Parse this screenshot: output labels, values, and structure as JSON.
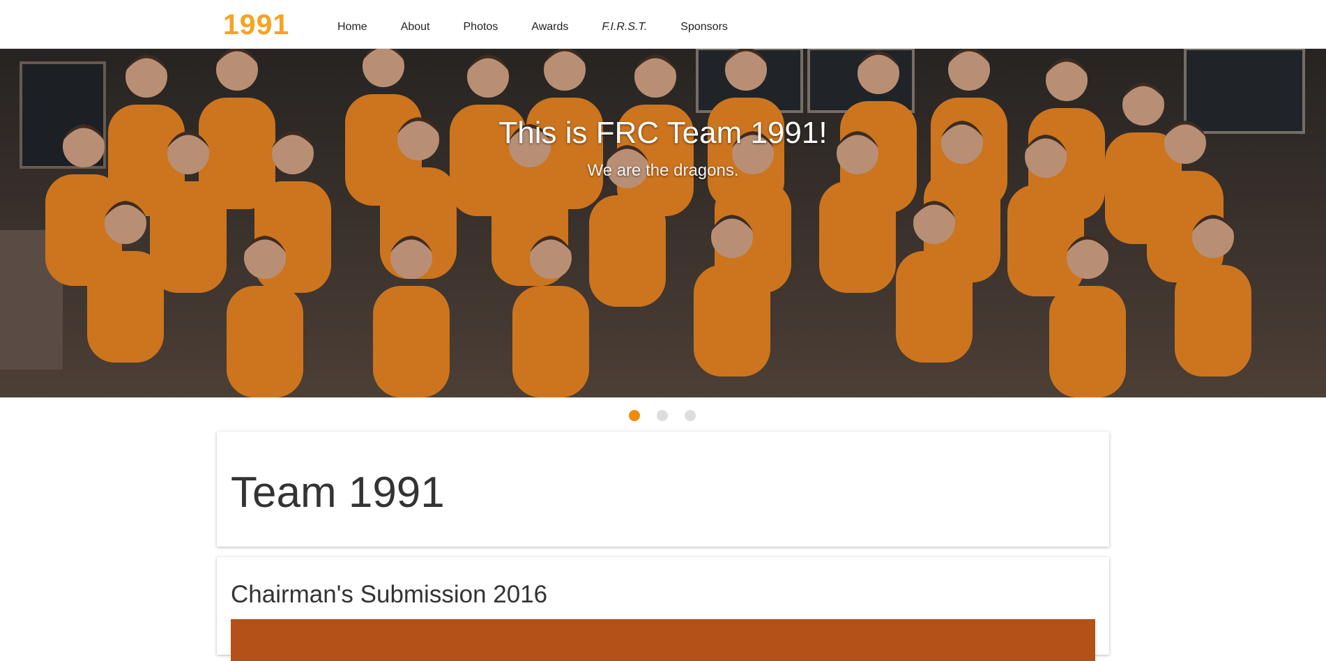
{
  "navbar": {
    "brand": "1991",
    "items": [
      {
        "label": "Home"
      },
      {
        "label": "About"
      },
      {
        "label": "Photos"
      },
      {
        "label": "Awards"
      },
      {
        "label": "F.I.R.S.T."
      },
      {
        "label": "Sponsors"
      }
    ]
  },
  "hero": {
    "title": "This is FRC Team 1991!",
    "subtitle": "We are the dragons.",
    "slide_count": 3,
    "active_slide": 1
  },
  "team_card": {
    "heading": "Team 1991"
  },
  "chairman_card": {
    "heading": "Chairman's Submission 2016"
  },
  "colors": {
    "brand": "#f7a31f",
    "dot_active": "#f18a0d",
    "dot_inactive": "#dddddd",
    "shirt_orange": "#f08a24",
    "media_block": "#b35119"
  }
}
